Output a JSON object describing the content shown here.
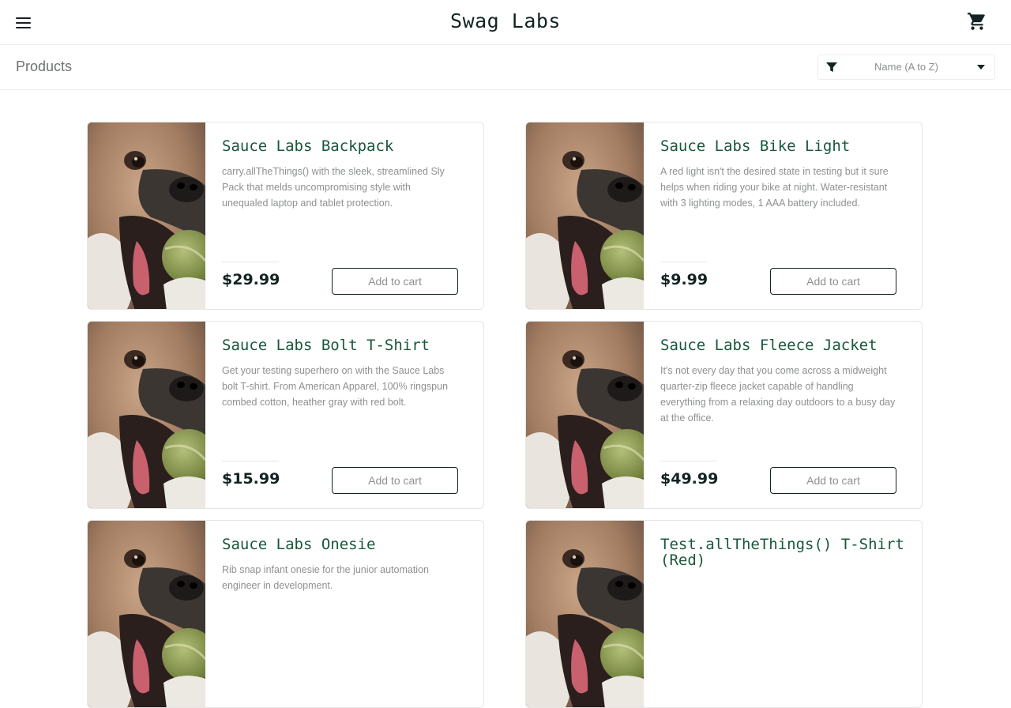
{
  "header": {
    "title": "Swag Labs",
    "menu_icon": "hamburger-menu-icon",
    "cart_icon": "shopping-cart-icon"
  },
  "sub_header": {
    "title": "Products",
    "sort": {
      "icon": "filter-icon",
      "selected": "Name (A to Z)"
    }
  },
  "products": [
    {
      "name": "Sauce Labs Backpack",
      "description": "carry.allTheThings() with the sleek, streamlined Sly Pack that melds uncompromising style with unequaled laptop and tablet protection.",
      "price": "$29.99",
      "button": "Add to cart"
    },
    {
      "name": "Sauce Labs Bike Light",
      "description": "A red light isn't the desired state in testing but it sure helps when riding your bike at night. Water-resistant with 3 lighting modes, 1 AAA battery included.",
      "price": "$9.99",
      "button": "Add to cart"
    },
    {
      "name": "Sauce Labs Bolt T-Shirt",
      "description": "Get your testing superhero on with the Sauce Labs bolt T-shirt. From American Apparel, 100% ringspun combed cotton, heather gray with red bolt.",
      "price": "$15.99",
      "button": "Add to cart"
    },
    {
      "name": "Sauce Labs Fleece Jacket",
      "description": "It's not every day that you come across a midweight quarter-zip fleece jacket capable of handling everything from a relaxing day outdoors to a busy day at the office.",
      "price": "$49.99",
      "button": "Add to cart"
    },
    {
      "name": "Sauce Labs Onesie",
      "description": "Rib snap infant onesie for the junior automation engineer in development.",
      "price": "",
      "button": ""
    },
    {
      "name": "Test.allTheThings() T-Shirt (Red)",
      "description": "",
      "price": "",
      "button": ""
    }
  ],
  "colors": {
    "brand_text": "#132322",
    "product_name": "#18583a",
    "muted_text": "#8e9190",
    "border": "#e6e6e6"
  }
}
